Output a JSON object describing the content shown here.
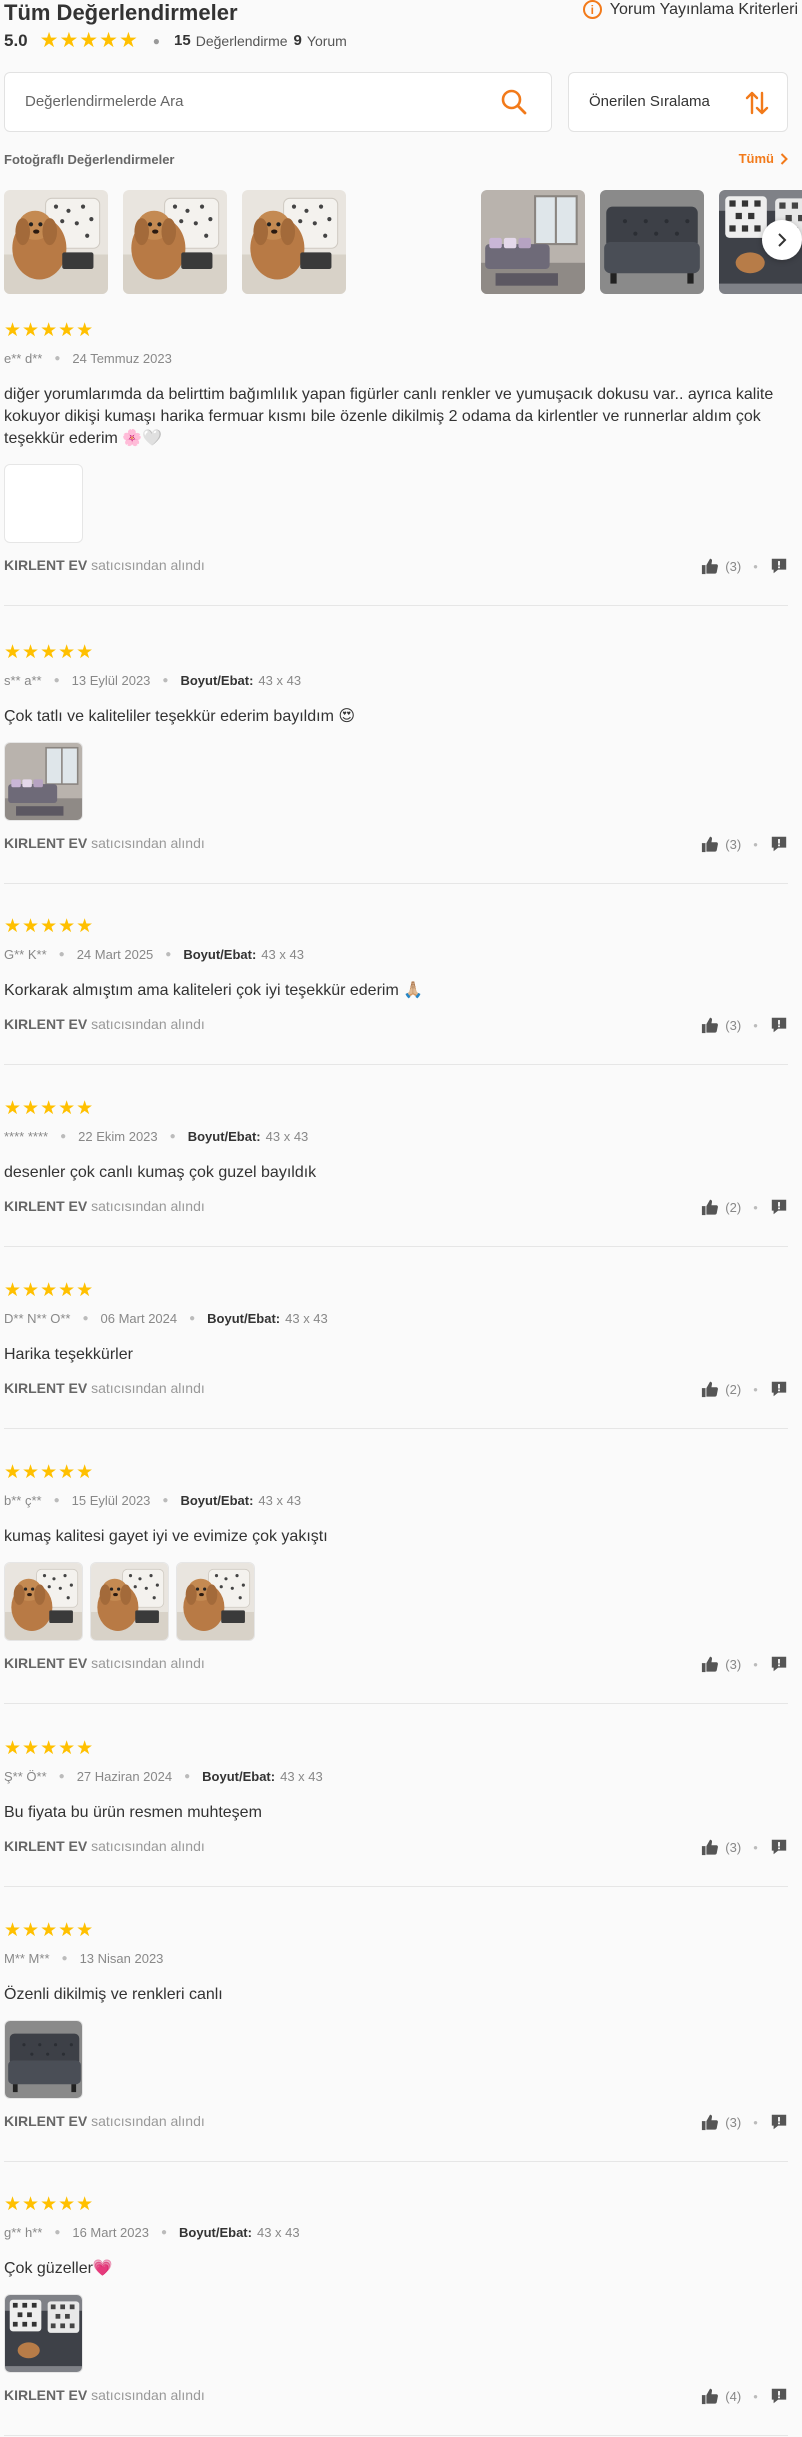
{
  "header": {
    "title": "Tüm Değerlendirmeler",
    "criteria_label": "Yorum Yayınlama Kriterleri",
    "rating_value": "5.0",
    "rating_count": "15",
    "rating_label": "Değerlendirme",
    "review_count": "9",
    "review_label": "Yorum",
    "star_color": "#ffc000",
    "accent_color": "#f27a1a"
  },
  "search": {
    "placeholder": "Değerlendirmelerde Ara",
    "icon": "search-icon"
  },
  "sort": {
    "label": "Önerilen Sıralama",
    "icon": "sort-arrows-icon"
  },
  "gallery": {
    "title": "Fotoğraflı Değerlendirmeler",
    "all_label": "Tümü",
    "photos": [
      "dog-on-pillows",
      "dog-on-pillows",
      "dog-on-pillows",
      "living-room-sofa",
      "dark-sofa",
      "dark-sofa-pillows"
    ]
  },
  "reviews": [
    {
      "user": "e** d**",
      "date": "24 Temmuz 2023",
      "size_label": "",
      "size_value": "",
      "text": "diğer yorumlarımda da belirttim bağımlılık yapan figürler canlı renkler ve yumuşacık dokusu var.. ayrıca kalite kokuyor dikişi kumaşı harika fermuar kısmı bile özenle dikilmiş 2 odama da kirlentler ve runnerlar aldım çok teşekkür ederim 🌸🤍",
      "photos": [
        "blank"
      ],
      "seller": "KIRLENT EV",
      "seller_suffix": "satıcısından alındı",
      "likes": "(3)"
    },
    {
      "user": "s** a**",
      "date": "13 Eylül 2023",
      "size_label": "Boyut/Ebat:",
      "size_value": "43 x 43",
      "text": "Çok tatlı ve kaliteliler teşekkür ederim bayıldım 😍",
      "photos": [
        "living-room-sofa"
      ],
      "seller": "KIRLENT EV",
      "seller_suffix": "satıcısından alındı",
      "likes": "(3)"
    },
    {
      "user": "G** K**",
      "date": "24 Mart 2025",
      "size_label": "Boyut/Ebat:",
      "size_value": "43 x 43",
      "text": "Korkarak almıştım ama kaliteleri çok iyi teşekkür ederim 🙏🏼",
      "photos": [],
      "seller": "KIRLENT EV",
      "seller_suffix": "satıcısından alındı",
      "likes": "(3)"
    },
    {
      "user": "**** ****",
      "date": "22 Ekim 2023",
      "size_label": "Boyut/Ebat:",
      "size_value": "43 x 43",
      "text": "desenler çok canlı kumaş çok guzel bayıldık",
      "photos": [],
      "seller": "KIRLENT EV",
      "seller_suffix": "satıcısından alındı",
      "likes": "(2)"
    },
    {
      "user": "D** N** O**",
      "date": "06 Mart 2024",
      "size_label": "Boyut/Ebat:",
      "size_value": "43 x 43",
      "text": "Harika teşekkürler",
      "photos": [],
      "seller": "KIRLENT EV",
      "seller_suffix": "satıcısından alındı",
      "likes": "(2)"
    },
    {
      "user": "b** ç**",
      "date": "15 Eylül 2023",
      "size_label": "Boyut/Ebat:",
      "size_value": "43 x 43",
      "text": "kumaş kalitesi gayet iyi ve evimize çok yakıştı",
      "photos": [
        "dog-on-pillows",
        "dog-on-pillows",
        "dog-on-pillows"
      ],
      "seller": "KIRLENT EV",
      "seller_suffix": "satıcısından alındı",
      "likes": "(3)"
    },
    {
      "user": "Ş** Ö**",
      "date": "27 Haziran 2024",
      "size_label": "Boyut/Ebat:",
      "size_value": "43 x 43",
      "text": "Bu fiyata bu ürün resmen muhteşem",
      "photos": [],
      "seller": "KIRLENT EV",
      "seller_suffix": "satıcısından alındı",
      "likes": "(3)"
    },
    {
      "user": "M** M**",
      "date": "13 Nisan 2023",
      "size_label": "",
      "size_value": "",
      "text": "Özenli dikilmiş ve renkleri canlı",
      "photos": [
        "dark-sofa"
      ],
      "seller": "KIRLENT EV",
      "seller_suffix": "satıcısından alındı",
      "likes": "(3)"
    },
    {
      "user": "g** h**",
      "date": "16 Mart 2023",
      "size_label": "Boyut/Ebat:",
      "size_value": "43 x 43",
      "text": "Çok güzeller💗",
      "photos": [
        "dark-sofa-pillows"
      ],
      "seller": "KIRLENT EV",
      "seller_suffix": "satıcısından alındı",
      "likes": "(4)"
    }
  ]
}
